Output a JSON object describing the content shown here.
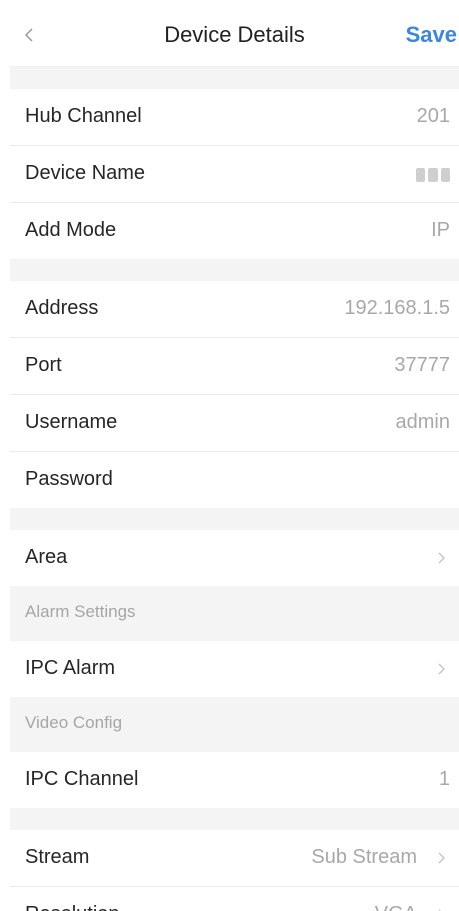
{
  "header": {
    "back_icon": "chevron-left-icon",
    "title": "Device Details",
    "save_label": "Save",
    "accent_color": "#3a86e0"
  },
  "group1": [
    {
      "label": "Hub Channel",
      "value": "201"
    },
    {
      "label": "Device Name",
      "value": ""
    },
    {
      "label": "Add Mode",
      "value": "IP"
    }
  ],
  "group2": [
    {
      "label": "Address",
      "value": "192.168.1.5"
    },
    {
      "label": "Port",
      "value": "37777"
    },
    {
      "label": "Username",
      "value": "admin"
    },
    {
      "label": "Password",
      "value": ""
    }
  ],
  "area": {
    "label": "Area",
    "icon": "chevron-right-icon"
  },
  "alarm_settings": {
    "section_title": "Alarm Settings",
    "ipc_alarm_label": "IPC Alarm"
  },
  "video_config": {
    "section_title": "Video Config",
    "ipc_channel_label": "IPC Channel",
    "ipc_channel_value": "1"
  },
  "stream": {
    "label": "Stream",
    "value": "Sub Stream"
  },
  "resolution": {
    "label": "Resolution",
    "value": "VGA"
  }
}
